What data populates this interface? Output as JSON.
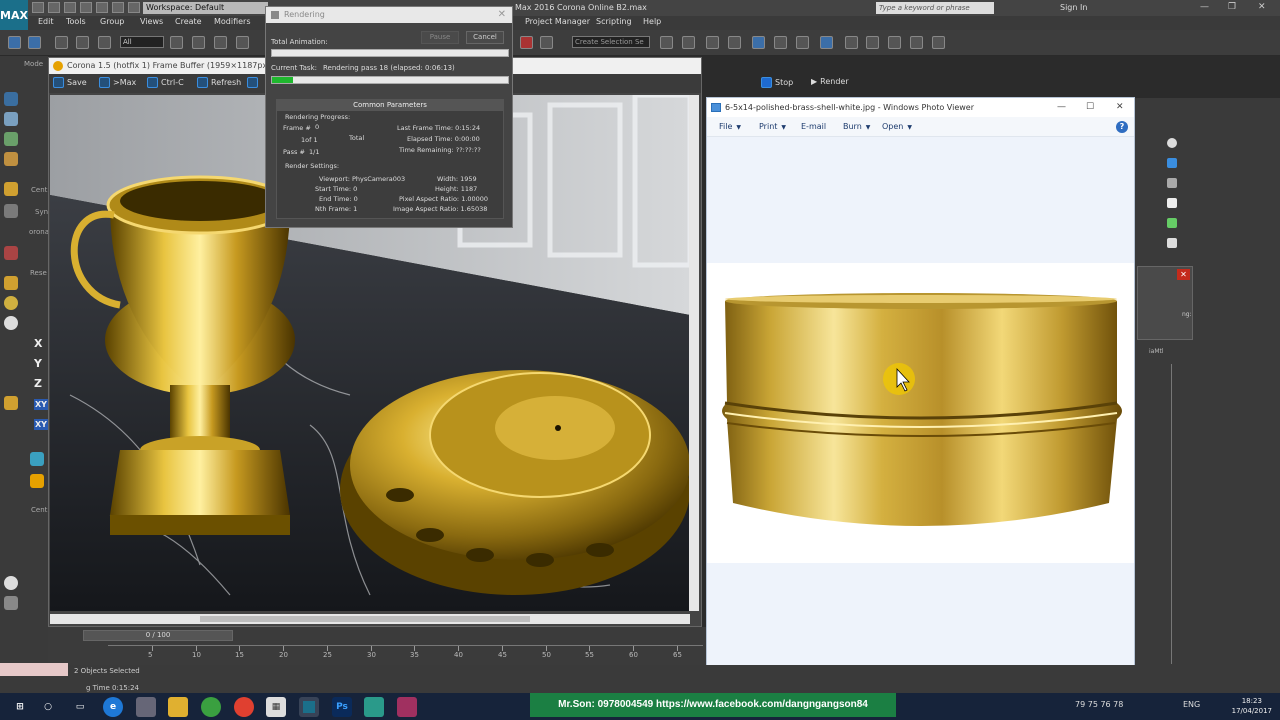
{
  "max": {
    "logo": "MAX",
    "workspace": "Workspace: Default",
    "title_text": "Max 2016      Corona Online B2.max",
    "search_placeholder": "Type a keyword or phrase",
    "sign_in": "Sign In",
    "menu": [
      "Edit",
      "Tools",
      "Group",
      "Views",
      "Create",
      "Modifiers",
      "Project Manager",
      "Scripting",
      "Help"
    ],
    "selection_filter": "All",
    "named_selection": "Create Selection Se",
    "left_labels": {
      "mode": "Mode",
      "cent": "Cent",
      "syn": "Syn",
      "corona": "orona",
      "rese": "Rese",
      "cent2": "Cent"
    },
    "axes": [
      "X",
      "Y",
      "Z",
      "XY",
      "XY"
    ],
    "right_panel_text": {
      "ng": "ng:",
      "mtl": "iaMtl"
    }
  },
  "vfb": {
    "title": "Corona 1.5 (hotfix 1) Frame Buffer (1959×1187px, 1:1)",
    "buttons": {
      "save": "Save",
      "max": ">Max",
      "ctrlc": "Ctrl-C",
      "refresh": "Refresh",
      "stop": "Stop",
      "render": "Render"
    }
  },
  "render_dialog": {
    "title": "Rendering",
    "total_label": "Total Animation:",
    "pause": "Pause",
    "cancel": "Cancel",
    "current_task_label": "Current Task:",
    "current_task": "Rendering pass 18 (elapsed: 0:06:13)",
    "current_progress": 0.09,
    "total_progress": 0.0,
    "section": "Common Parameters",
    "progress_group": "Rendering Progress:",
    "frame_label": "Frame #",
    "frame_value": "0",
    "of_label": "1of 1",
    "total_word": "Total",
    "pass_label": "Pass #",
    "pass_value": "1/1",
    "last_frame_time": "Last Frame Time:  0:15:24",
    "elapsed_time": "Elapsed Time:  0:00:00",
    "time_remaining": "Time Remaining:  ??:??:??",
    "settings_group": "Render Settings:",
    "viewport": "Viewport:  PhysCamera003",
    "start_time": "Start Time:  0",
    "end_time": "End Time:  0",
    "nth_frame": "Nth Frame:  1",
    "width": "Width:  1959",
    "height": "Height:  1187",
    "pixel_aspect": "Pixel Aspect Ratio:  1.00000",
    "image_aspect": "Image Aspect Ratio:  1.65038"
  },
  "photo_viewer": {
    "title": "6-5x14-polished-brass-shell-white.jpg - Windows Photo Viewer",
    "menu": [
      "File",
      "Print",
      "E-mail",
      "Burn",
      "Open"
    ],
    "help": "?"
  },
  "timeline": {
    "slider": "0 / 100",
    "ticks": [
      "5",
      "10",
      "15",
      "20",
      "25",
      "30",
      "35",
      "40",
      "45",
      "50",
      "55",
      "60",
      "65"
    ]
  },
  "status": {
    "selected": "2 Objects Selected",
    "render_time": "g Time  0:15:24"
  },
  "taskbar": {
    "watermark": "Mr.Son:  0978004549   https://www.facebook.com/dangngangson84",
    "tray_numbers": "79   75   76   78",
    "lang": "ENG",
    "time": "18:23",
    "date": "17/04/2017"
  },
  "colors": {
    "accent_blue": "#1e78d6",
    "progress_green": "#1fb82e",
    "brass": "#c9a227",
    "watermark_green": "#1b7f43"
  }
}
